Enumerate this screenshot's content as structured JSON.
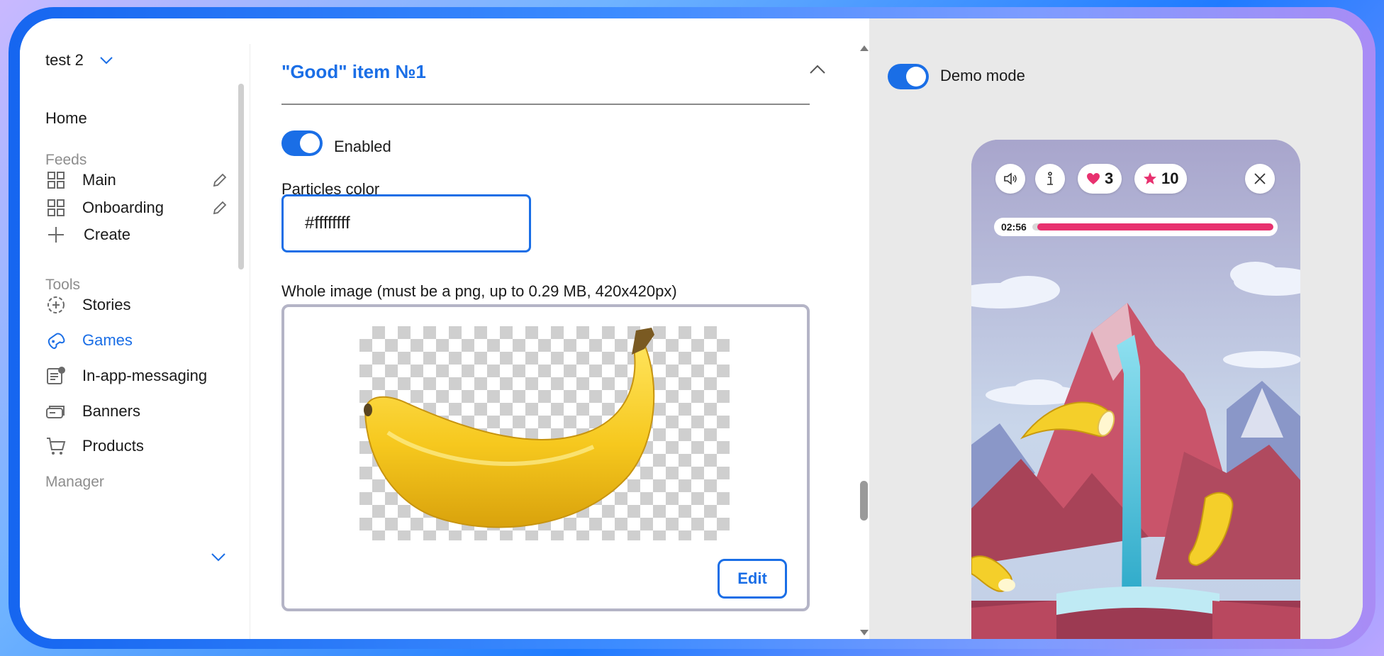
{
  "sidebar": {
    "project_name": "test 2",
    "home": "Home",
    "sections": {
      "feeds": "Feeds",
      "tools": "Tools",
      "manager": "Manager"
    },
    "feeds": [
      {
        "label": "Main",
        "icon": "grid-icon"
      },
      {
        "label": "Onboarding",
        "icon": "grid-icon"
      }
    ],
    "create": "Create",
    "tools": [
      {
        "label": "Stories",
        "icon": "stories-icon",
        "active": false
      },
      {
        "label": "Games",
        "icon": "gamepad-icon",
        "active": true
      },
      {
        "label": "In-app-messaging",
        "icon": "message-icon",
        "active": false
      },
      {
        "label": "Banners",
        "icon": "banners-icon",
        "active": false
      },
      {
        "label": "Products",
        "icon": "cart-icon",
        "active": false
      }
    ]
  },
  "form": {
    "item_title": "\"Good\" item №1",
    "enabled_label": "Enabled",
    "enabled": true,
    "particles_label": "Particles color",
    "particles_value": "#ffffffff",
    "image_label": "Whole image (must be a png, up to 0.29 MB, 420x420px)",
    "edit_button": "Edit"
  },
  "preview": {
    "demo_label": "Demo mode",
    "demo_enabled": true,
    "lives": "3",
    "stars": "10",
    "timer": "02:56",
    "progress_fraction": 0.98
  },
  "colors": {
    "accent": "#1a6ee6",
    "progress": "#e8316f",
    "heart": "#e8316f"
  }
}
